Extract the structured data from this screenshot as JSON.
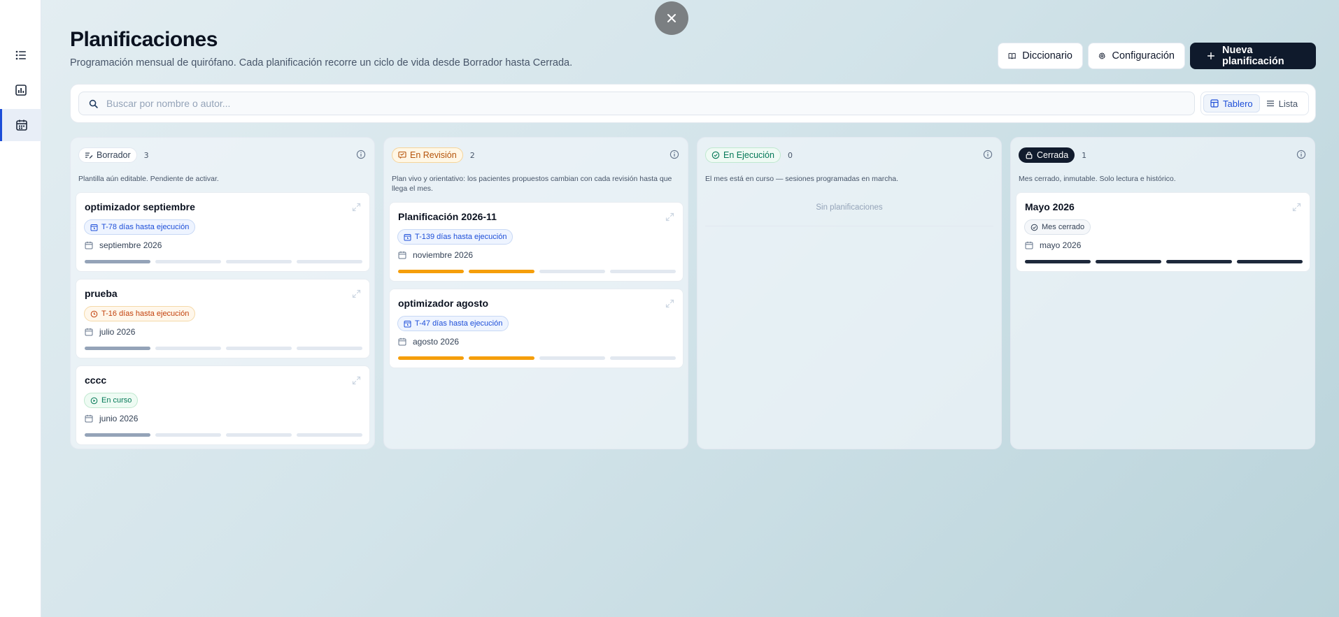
{
  "header": {
    "title": "Planificaciones",
    "subtitle": "Programación mensual de quirófano. Cada planificación recorre un ciclo de vida desde Borrador hasta Cerrada."
  },
  "actions": {
    "dictionary": "Diccionario",
    "settings": "Configuración",
    "new_plan": "Nueva planificación"
  },
  "search": {
    "placeholder": "Buscar por nombre o autor..."
  },
  "view_toggle": {
    "board": "Tablero",
    "list": "Lista",
    "selected": "Tablero"
  },
  "sidebar": {
    "items": [
      {
        "icon": "list-icon",
        "active": false
      },
      {
        "icon": "chart-icon",
        "active": false
      },
      {
        "icon": "calendar-icon",
        "active": true
      }
    ]
  },
  "colors": {
    "draft": "#64748b",
    "review": "#f59e0b",
    "running": "#10b981",
    "closed": "#1e293b",
    "accent": "#1d4ed8",
    "progress_empty": "#e2e8f0"
  },
  "columns": [
    {
      "label": "Borrador",
      "count": "3",
      "description": "Plantilla aún editable. Pendiente de activar.",
      "empty_text": "",
      "cards": [
        {
          "title": "optimizador septiembre",
          "badge": "T-78 días hasta ejecución",
          "badge_style": "blue",
          "badge_icon": "calendar-clock-icon",
          "date": "septiembre 2026",
          "progress": [
            1,
            0,
            0,
            0
          ],
          "progress_color": "#94a3b8"
        },
        {
          "title": "prueba",
          "badge": "T-16 días hasta ejecución",
          "badge_style": "orange",
          "badge_icon": "clock-icon",
          "date": "julio 2026",
          "progress": [
            1,
            0,
            0,
            0
          ],
          "progress_color": "#94a3b8"
        },
        {
          "title": "cccc",
          "badge": "En curso",
          "badge_style": "green",
          "badge_icon": "play-circle-icon",
          "date": "junio 2026",
          "progress": [
            1,
            0,
            0,
            0
          ],
          "progress_color": "#94a3b8"
        }
      ]
    },
    {
      "label": "En Revisión",
      "count": "2",
      "description": "Plan vivo y orientativo: los pacientes propuestos cambian con cada revisión hasta que llega el mes.",
      "empty_text": "",
      "cards": [
        {
          "title": "Planificación 2026-11",
          "badge": "T-139 días hasta ejecución",
          "badge_style": "blue",
          "badge_icon": "calendar-clock-icon",
          "date": "noviembre 2026",
          "progress": [
            1,
            1,
            0,
            0
          ],
          "progress_color": "#f59e0b"
        },
        {
          "title": "optimizador agosto",
          "badge": "T-47 días hasta ejecución",
          "badge_style": "blue",
          "badge_icon": "calendar-clock-icon",
          "date": "agosto 2026",
          "progress": [
            1,
            1,
            0,
            0
          ],
          "progress_color": "#f59e0b"
        }
      ]
    },
    {
      "label": "En Ejecución",
      "count": "0",
      "description": "El mes está en curso — sesiones programadas en marcha.",
      "empty_text": "Sin planificaciones",
      "cards": []
    },
    {
      "label": "Cerrada",
      "count": "1",
      "description": "Mes cerrado, inmutable. Solo lectura e histórico.",
      "empty_text": "",
      "cards": [
        {
          "title": "Mayo 2026",
          "badge": "Mes cerrado",
          "badge_style": "gray",
          "badge_icon": "check-circle-icon",
          "date": "mayo 2026",
          "progress": [
            1,
            1,
            1,
            1
          ],
          "progress_color": "#1e293b"
        }
      ]
    }
  ]
}
